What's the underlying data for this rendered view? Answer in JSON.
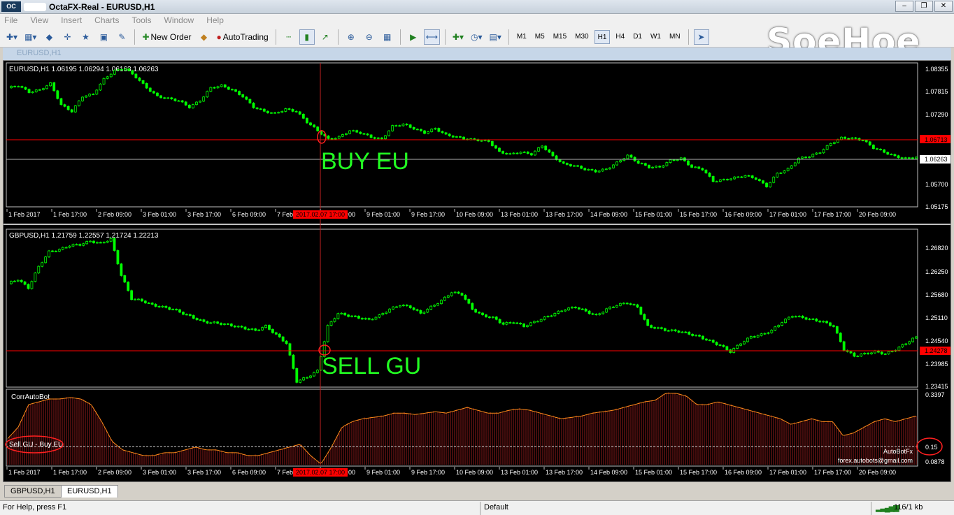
{
  "window": {
    "title": "OctaFX-Real - EURUSD,H1",
    "logo": "OC",
    "controls": [
      "minimize-icon",
      "restore-icon",
      "close-icon"
    ]
  },
  "menu": [
    "File",
    "View",
    "Insert",
    "Charts",
    "Tools",
    "Window",
    "Help"
  ],
  "toolbar": {
    "new_order": "New Order",
    "autotrading": "AutoTrading",
    "timeframes": [
      "M1",
      "M5",
      "M15",
      "M30",
      "H1",
      "H4",
      "D1",
      "W1",
      "MN"
    ],
    "active_timeframe": "H1"
  },
  "brand": "SoeHoe",
  "child_window_title": "EURUSD,H1",
  "eurusd": {
    "header": "EURUSD,H1  1.06195 1.06294 1.06163 1.06263",
    "annotation": "BUY EU",
    "price_labels": [
      "1.08355",
      "1.07815",
      "1.07290",
      "1.06713",
      "1.06263",
      "1.05700",
      "1.05175"
    ],
    "current_price": "1.06263",
    "line_price": "1.06713",
    "line_color": "#ff0000",
    "candle_color": "#00ff00",
    "series_y": [
      1.079,
      1.0795,
      1.078,
      1.0785,
      1.08,
      1.075,
      1.0735,
      1.077,
      1.0775,
      1.081,
      1.083,
      1.0835,
      1.0815,
      1.079,
      1.077,
      1.0765,
      1.076,
      1.0745,
      1.076,
      1.079,
      1.0795,
      1.0785,
      1.077,
      1.0745,
      1.0735,
      1.073,
      1.074,
      1.0735,
      1.071,
      1.069,
      1.067,
      1.0675,
      1.069,
      1.0685,
      1.0675,
      1.067,
      1.07,
      1.0705,
      1.0695,
      1.0685,
      1.0695,
      1.068,
      1.0675,
      1.067,
      1.0668,
      1.0665,
      1.064,
      1.0635,
      1.064,
      1.0635,
      1.0655,
      1.063,
      1.0612,
      1.0608,
      1.06,
      1.0595,
      1.06,
      1.0615,
      1.0632,
      1.0615,
      1.0605,
      1.0605,
      1.062,
      1.0625,
      1.0605,
      1.06,
      1.0572,
      1.0575,
      1.058,
      1.0585,
      1.0578,
      1.056,
      1.059,
      1.06,
      1.0625,
      1.063,
      1.064,
      1.066,
      1.0673,
      1.0672,
      1.0668,
      1.065,
      1.064,
      1.063,
      1.0625,
      1.0628
    ]
  },
  "gbpusd": {
    "header": "GBPUSD,H1  1.21759 1.22557 1.21724 1.22213",
    "annotation": "SELL GU",
    "price_labels": [
      "1.26820",
      "1.26250",
      "1.25680",
      "1.25110",
      "1.24540",
      "1.23985",
      "1.23415"
    ],
    "current_price": "1.24278",
    "series_y": [
      1.258,
      1.259,
      1.257,
      1.262,
      1.2655,
      1.266,
      1.267,
      1.2672,
      1.268,
      1.2675,
      1.2685,
      1.26,
      1.2545,
      1.254,
      1.253,
      1.2525,
      1.252,
      1.251,
      1.25,
      1.249,
      1.2488,
      1.2485,
      1.248,
      1.2475,
      1.247,
      1.248,
      1.246,
      1.244,
      1.235,
      1.236,
      1.2375,
      1.248,
      1.251,
      1.2505,
      1.25,
      1.2495,
      1.2505,
      1.252,
      1.253,
      1.2525,
      1.251,
      1.2525,
      1.254,
      1.256,
      1.2555,
      1.252,
      1.2505,
      1.25,
      1.2485,
      1.249,
      1.248,
      1.249,
      1.25,
      1.251,
      1.252,
      1.2525,
      1.2515,
      1.2505,
      1.252,
      1.253,
      1.2535,
      1.2525,
      1.248,
      1.2475,
      1.247,
      1.2468,
      1.2462,
      1.2455,
      1.2445,
      1.2435,
      1.242,
      1.244,
      1.2455,
      1.246,
      1.247,
      1.249,
      1.2505,
      1.25,
      1.2495,
      1.249,
      1.248,
      1.2425,
      1.241,
      1.2415,
      1.242,
      1.2415,
      1.2425,
      1.244,
      1.2455
    ]
  },
  "indicator": {
    "name": "CorrAutoBot",
    "signal_label": "Sell GU - Buy EU",
    "price_labels": [
      "0.3397",
      "0.15",
      "0.0878"
    ],
    "footer": [
      "AutoBotFx",
      "forex.autobots@gmail.com"
    ],
    "series_y": [
      0.18,
      0.22,
      0.3,
      0.31,
      0.32,
      0.32,
      0.325,
      0.32,
      0.3,
      0.24,
      0.17,
      0.14,
      0.13,
      0.12,
      0.12,
      0.13,
      0.13,
      0.14,
      0.15,
      0.14,
      0.14,
      0.13,
      0.13,
      0.12,
      0.12,
      0.13,
      0.14,
      0.15,
      0.16,
      0.12,
      0.09,
      0.15,
      0.22,
      0.24,
      0.25,
      0.255,
      0.26,
      0.27,
      0.27,
      0.265,
      0.27,
      0.275,
      0.27,
      0.28,
      0.29,
      0.28,
      0.27,
      0.27,
      0.28,
      0.285,
      0.28,
      0.27,
      0.26,
      0.25,
      0.255,
      0.26,
      0.27,
      0.275,
      0.28,
      0.29,
      0.3,
      0.31,
      0.315,
      0.34,
      0.34,
      0.33,
      0.3,
      0.3,
      0.31,
      0.3,
      0.29,
      0.28,
      0.27,
      0.26,
      0.25,
      0.23,
      0.24,
      0.25,
      0.24,
      0.24,
      0.19,
      0.2,
      0.22,
      0.24,
      0.25,
      0.24,
      0.25,
      0.26
    ]
  },
  "time_labels": [
    "1 Feb 2017",
    "1 Feb 17:00",
    "2 Feb 09:00",
    "3 Feb 01:00",
    "3 Feb 17:00",
    "6 Feb 09:00",
    "7 Feb",
    "8 Feb 09:00",
    "9 Feb 01:00",
    "9 Feb 17:00",
    "10 Feb 09:00",
    "13 Feb 01:00",
    "13 Feb 17:00",
    "14 Feb 09:00",
    "15 Feb 01:00",
    "15 Feb 17:00",
    "16 Feb 09:00",
    "17 Feb 01:00",
    "17 Feb 17:00",
    "20 Feb 09:00"
  ],
  "crosshair_time": "2017.02.07 17:00",
  "tabs": [
    "GBPUSD,H1",
    "EURUSD,H1"
  ],
  "active_tab": "EURUSD,H1",
  "status": {
    "help": "For Help, press F1",
    "profile": "Default",
    "traffic": "116/1 kb"
  }
}
